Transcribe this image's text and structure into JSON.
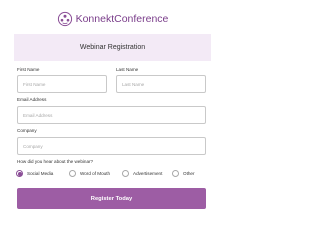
{
  "brand": {
    "name": "KonnektConference",
    "accent_color": "#8a4d96",
    "logo_icon": "people-network-icon"
  },
  "form": {
    "title": "Webinar Registration",
    "header_bg": "#f3eaf6",
    "fields": {
      "first_name": {
        "label": "First Name",
        "value": "",
        "placeholder": "First Name"
      },
      "last_name": {
        "label": "Last Name",
        "value": "",
        "placeholder": "Last Name"
      },
      "email": {
        "label": "Email Address",
        "value": "",
        "placeholder": "Email Address"
      },
      "company": {
        "label": "Company",
        "value": "",
        "placeholder": "Company"
      }
    },
    "heard_about": {
      "label": "How did you hear about the webinar?",
      "selected": "Social Media",
      "options": [
        {
          "label": "Social Media",
          "checked": true
        },
        {
          "label": "Word of Mouth",
          "checked": false
        },
        {
          "label": "Advertisement",
          "checked": false
        },
        {
          "label": "Other",
          "checked": false
        }
      ]
    },
    "submit": {
      "label": "Register Today",
      "bg_color": "#9d5da4"
    }
  }
}
